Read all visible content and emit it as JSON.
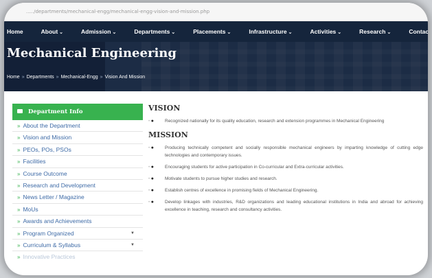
{
  "browser": {
    "url": "...../departments/mechanical-engg/mechanical-engg-vision-and-mission.php"
  },
  "nav": {
    "items": [
      {
        "label": "Home",
        "has_dropdown": false
      },
      {
        "label": "About",
        "has_dropdown": true
      },
      {
        "label": "Admission",
        "has_dropdown": true
      },
      {
        "label": "Departments",
        "has_dropdown": true
      },
      {
        "label": "Placements",
        "has_dropdown": true
      },
      {
        "label": "Infrastructure",
        "has_dropdown": true
      },
      {
        "label": "Activities",
        "has_dropdown": true
      },
      {
        "label": "Research",
        "has_dropdown": true
      },
      {
        "label": "Contact Us",
        "has_dropdown": false
      }
    ]
  },
  "banner": {
    "title": "Mechanical Engineering",
    "breadcrumb": [
      "Home",
      "Departments",
      "Mechanical-Engg",
      "Vision And Mission"
    ]
  },
  "sidebar": {
    "header": "Department Info",
    "items": [
      {
        "label": "About the Department",
        "dropdown": false
      },
      {
        "label": "Vision and Mission",
        "dropdown": false
      },
      {
        "label": "PEOs, POs, PSOs",
        "dropdown": false
      },
      {
        "label": "Facilities",
        "dropdown": false
      },
      {
        "label": "Course Outcome",
        "dropdown": false
      },
      {
        "label": "Research and Development",
        "dropdown": false
      },
      {
        "label": "News Letter / Magazine",
        "dropdown": false
      },
      {
        "label": "MoUs",
        "dropdown": false
      },
      {
        "label": "Awards and Achievements",
        "dropdown": false
      },
      {
        "label": "Program Organized",
        "dropdown": true
      },
      {
        "label": "Curriculum & Syllabus",
        "dropdown": true
      },
      {
        "label": "Innovative Practices",
        "dropdown": false
      }
    ]
  },
  "content": {
    "vision_heading": "VISION",
    "vision_items": [
      "Recognized nationally for its quality education, research and extension programmes in Mechanical Engineering"
    ],
    "mission_heading": "MISSION",
    "mission_items": [
      "Producing technically competent and socially responsible mechanical engineers by imparting knowledge of cutting edge technologies and contemporary issues.",
      "Encouraging students for active participation in Co-curricular and Extra-curricular activities.",
      "Motivate students to pursue higher studies and research.",
      "Establish centres of excellence in promising fields of Mechanical Engineering.",
      "Develop linkages with industries, R&D organizations and leading educational institutions in India and abroad for achieving excellence in teaching, research and consultancy activities."
    ]
  },
  "colors": {
    "nav_bg": "#15253c",
    "sidebar_header": "#38b24f",
    "link": "#3d6aa6"
  }
}
